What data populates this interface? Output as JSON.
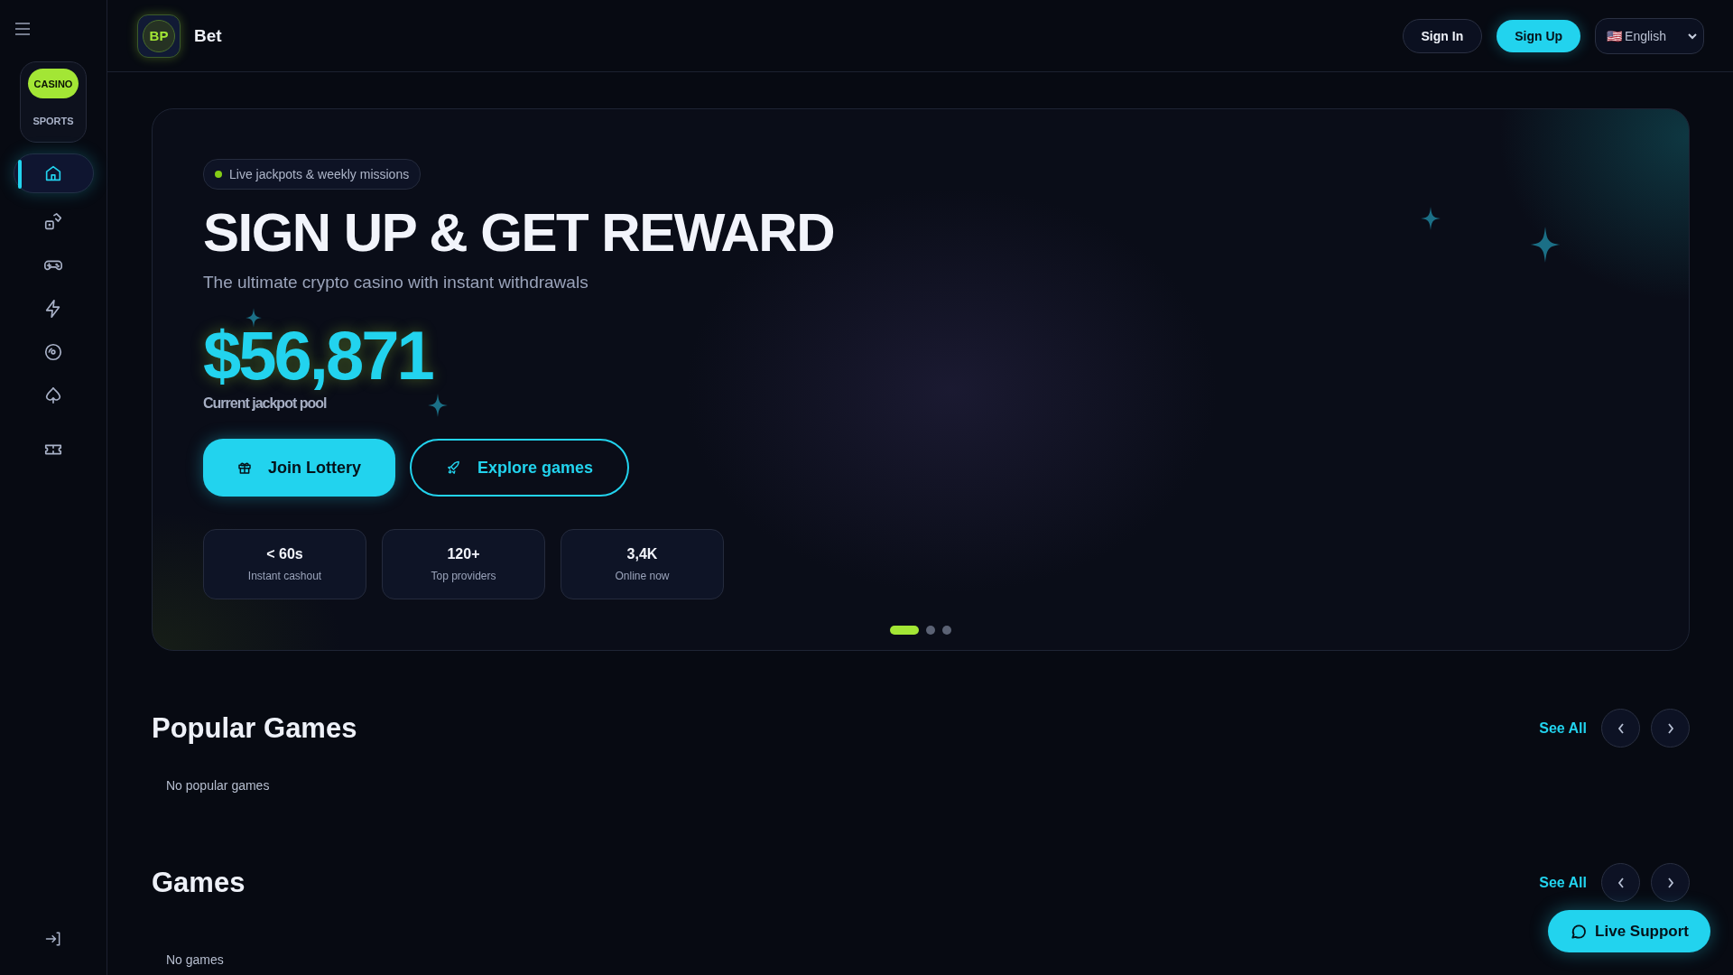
{
  "sidebar": {
    "modes": [
      {
        "label": "CASINO",
        "selected": true
      },
      {
        "label": "SPORTS",
        "selected": false
      }
    ],
    "items": [
      {
        "kind": "home",
        "selected": true
      },
      {
        "kind": "dice",
        "selected": false
      },
      {
        "kind": "gamepad",
        "selected": false
      },
      {
        "kind": "lightning",
        "selected": false
      },
      {
        "kind": "disc",
        "selected": false
      },
      {
        "kind": "spade",
        "selected": false
      },
      {
        "kind": "ticket",
        "selected": false
      }
    ]
  },
  "header": {
    "logo": "BP",
    "brand": "Bet",
    "sign_in": "Sign In",
    "sign_up": "Sign Up",
    "language": {
      "flag": "🇺🇸",
      "value": "English"
    }
  },
  "hero": {
    "badge": "Live jackpots & weekly missions",
    "title": "SIGN UP & GET REWARD",
    "subtitle": "The ultimate crypto casino with instant withdrawals",
    "amount": "$56,871",
    "amount_caption": "Current jackpot pool",
    "buttons": [
      {
        "kind": "primary",
        "label": "Join Lottery"
      },
      {
        "kind": "outline",
        "label": "Explore games"
      }
    ],
    "stats": [
      {
        "value": "< 60s",
        "label": "Instant cashout"
      },
      {
        "value": "120+",
        "label": "Top providers"
      },
      {
        "value": "3,4K",
        "label": "Online now"
      }
    ],
    "slides": [
      {
        "selected": true
      },
      {
        "selected": false
      },
      {
        "selected": false
      }
    ]
  },
  "sections": [
    {
      "title": "Popular Games",
      "see_all": "See All",
      "empty": "No popular games"
    },
    {
      "title": "Games",
      "see_all": "See All",
      "empty": "No games"
    }
  ],
  "live_support": "Live Support"
}
